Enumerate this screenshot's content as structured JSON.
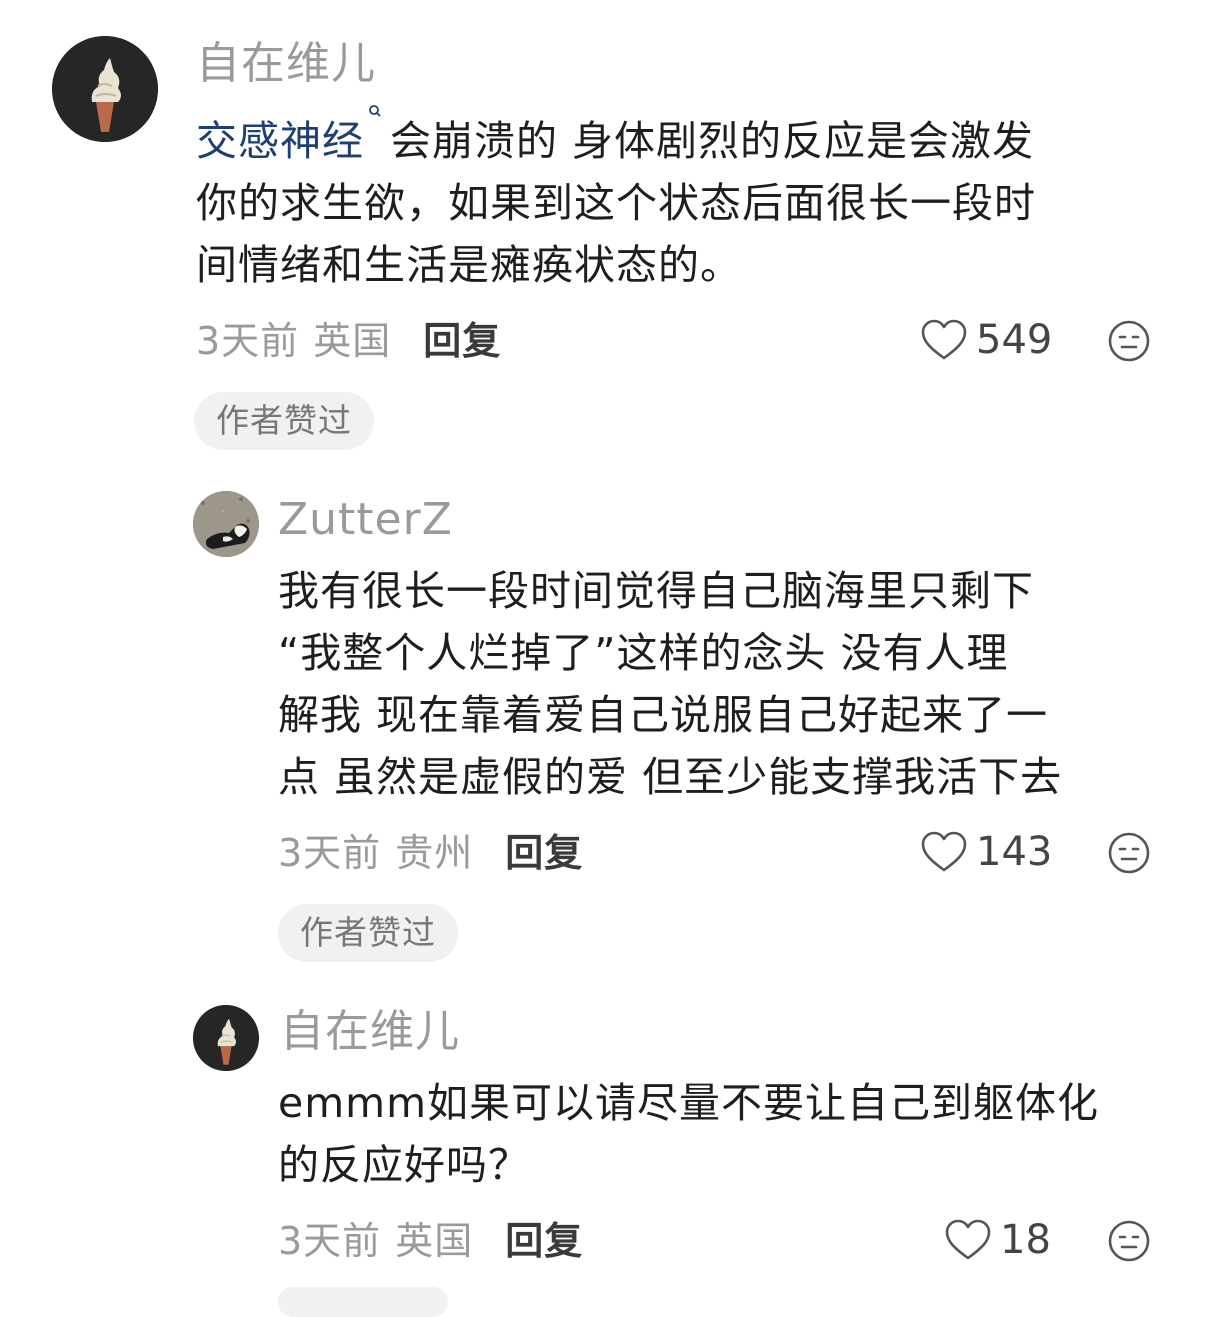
{
  "comments": [
    {
      "username": "自在维儿",
      "avatar": "soft-serve-ice-cream-avatar",
      "mention": "交感神经",
      "body_lines": [
        "会崩溃的 身体剧烈的反应是会激发",
        "你的求生欲，如果到这个状态后面很长一段时",
        "间情绪和生活是瘫痪状态的。"
      ],
      "time": "3天前",
      "location": "英国",
      "reply_label": "回复",
      "likes": "549",
      "badge": "作者赞过"
    },
    {
      "username": "ZutterZ",
      "avatar": "dog-on-gravel-avatar",
      "body_lines": [
        "我有很长一段时间觉得自己脑海里只剩下",
        "“我整个人烂掉了”这样的念头 没有人理",
        "解我 现在靠着爱自己说服自己好起来了一",
        "点 虽然是虚假的爱 但至少能支撑我活下去"
      ],
      "time": "3天前",
      "location": "贵州",
      "reply_label": "回复",
      "likes": "143",
      "badge": "作者赞过"
    },
    {
      "username": "自在维儿",
      "avatar": "soft-serve-ice-cream-avatar",
      "body_lines": [
        "emmm如果可以请尽量不要让自己到躯体化",
        "的反应好吗？"
      ],
      "time": "3天前",
      "location": "英国",
      "reply_label": "回复",
      "likes": "18"
    }
  ],
  "icons": {
    "like": "heart-outline-icon",
    "dislike": "neutral-face-icon",
    "mention_search": "search-icon"
  },
  "colors": {
    "mention": "#1f3f73",
    "muted": "#9a9a9a",
    "badge_bg": "#f1f1f1"
  }
}
